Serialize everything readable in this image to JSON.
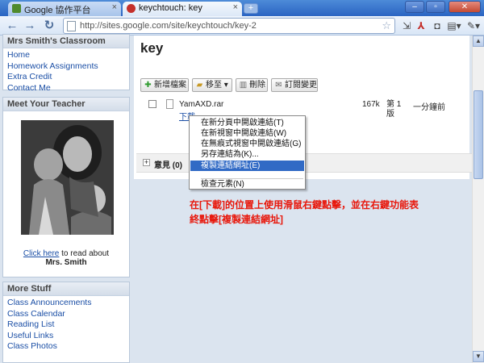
{
  "tabs": [
    {
      "title": "Google 協作平台",
      "active": false
    },
    {
      "title": "keychtouch: key",
      "active": true
    }
  ],
  "url": "http://sites.google.com/site/keychtouch/key-2",
  "sidebar": {
    "classroom_title": "Mrs Smith's Classroom",
    "classroom_links": [
      "Home",
      "Homework Assignments",
      "Extra Credit",
      "Contact Me"
    ],
    "teacher_title": "Meet Your Teacher",
    "caption_link": "Click here",
    "caption_text": " to read about",
    "caption_name": "Mrs. Smith",
    "more_title": "More Stuff",
    "more_links": [
      "Class Announcements",
      "Class Calendar",
      "Reading List",
      "Useful Links",
      "Class Photos"
    ]
  },
  "page": {
    "title": "key",
    "actions": {
      "add_file": "新增檔案",
      "move_to": "移至",
      "delete": "刪除",
      "subscribe": "訂閱變更"
    },
    "file": {
      "name": "YamAXD.rar",
      "download": "下載",
      "size": "167k",
      "version": "第 1 版",
      "time": "一分鐘前"
    },
    "comments": "意見 (0)"
  },
  "context_menu": [
    {
      "label": "在新分頁中開啟連結(T)",
      "highlighted": false
    },
    {
      "label": "在新視窗中開啟連結(W)",
      "highlighted": false
    },
    {
      "label": "在無痕式視窗中開啟連結(G)",
      "highlighted": false
    },
    {
      "label": "另存連結為(K)...",
      "highlighted": false
    },
    {
      "label": "複製連結網址(E)",
      "highlighted": true
    },
    {
      "label": "檢查元素(N)",
      "highlighted": false
    }
  ],
  "annotation": "在[下載]的位置上使用滑鼠右鍵點擊，並在右鍵功能表終點擊[複製連結網址]",
  "colors": {
    "link": "#1a4ea5",
    "highlight": "#316ac5",
    "annotation": "#e8170b"
  }
}
